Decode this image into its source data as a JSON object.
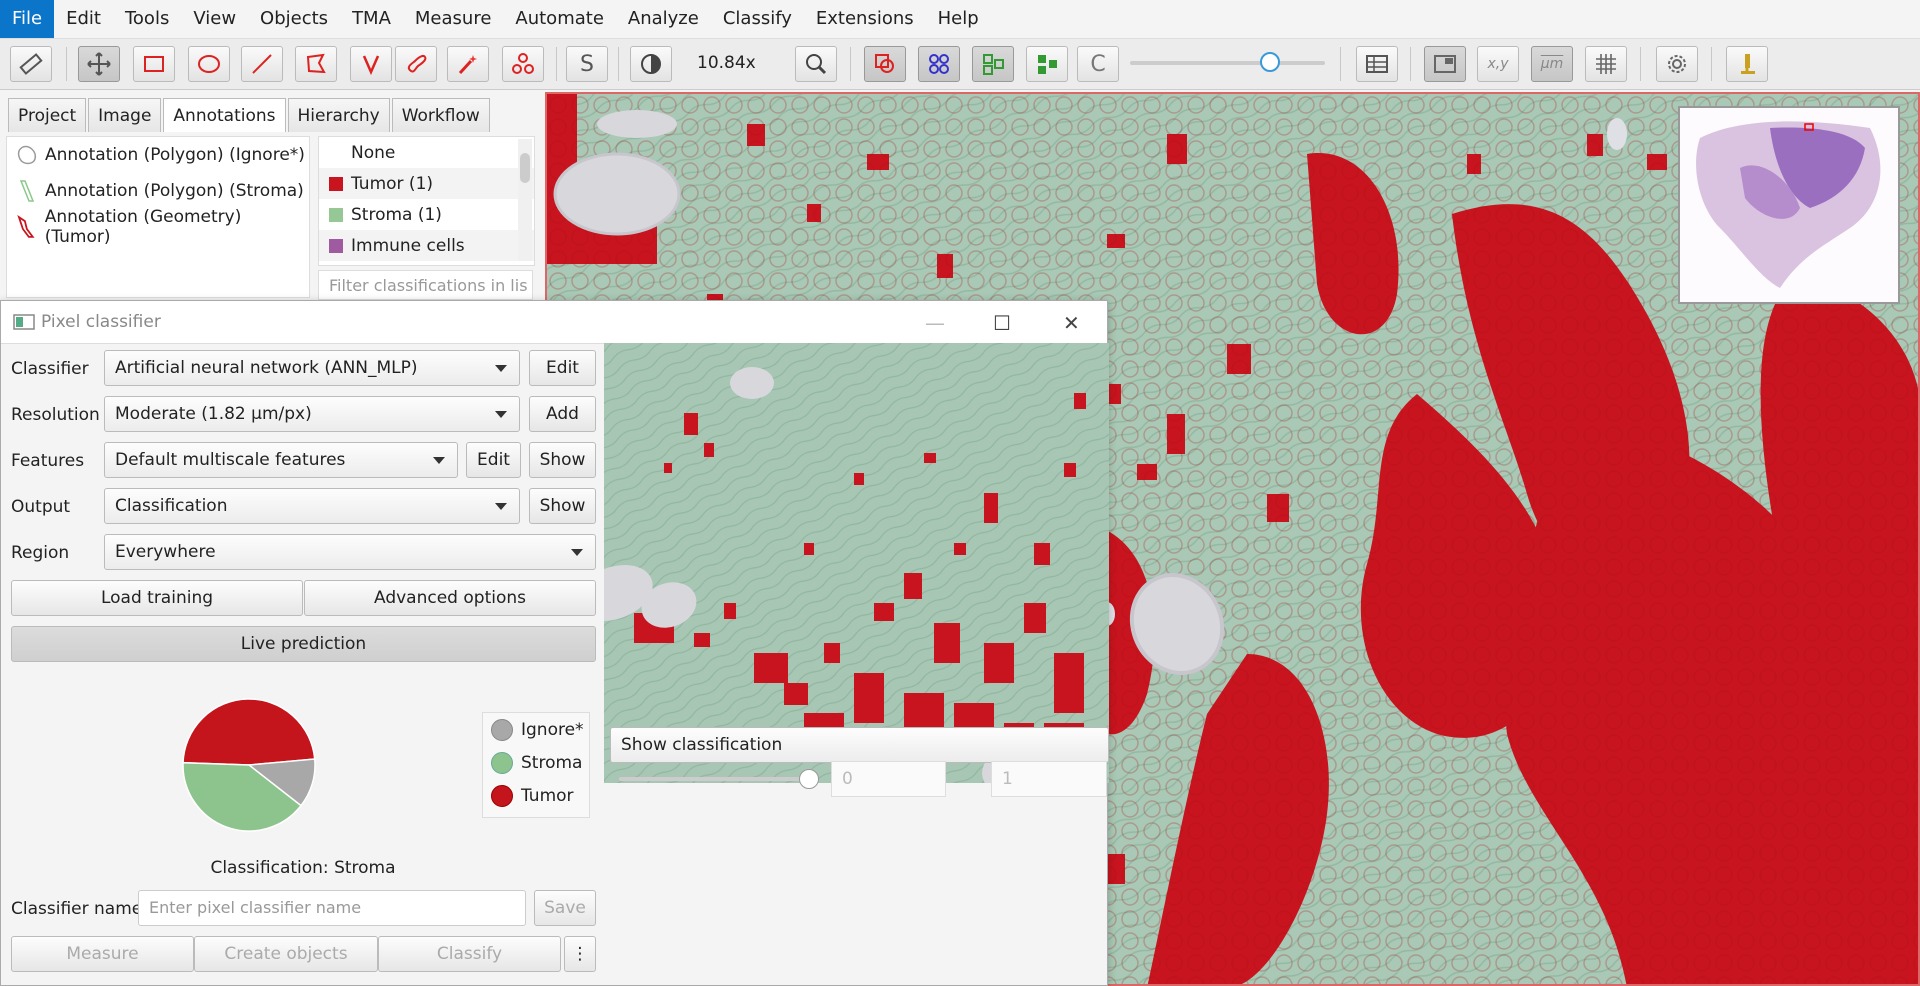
{
  "menu": [
    "File",
    "Edit",
    "Tools",
    "View",
    "Objects",
    "TMA",
    "Measure",
    "Automate",
    "Analyze",
    "Classify",
    "Extensions",
    "Help"
  ],
  "toolbar": {
    "zoom": "10.84x",
    "slider_level": 0.73
  },
  "tabs": [
    "Project",
    "Image",
    "Annotations",
    "Hierarchy",
    "Workflow"
  ],
  "annotations": [
    {
      "label": "Annotation (Polygon) (Ignore*)",
      "color": "#9a9a9a"
    },
    {
      "label": "Annotation (Polygon) (Stroma)",
      "color": "#8cc88c"
    },
    {
      "label": "Annotation (Geometry) (Tumor)",
      "color": "#c8141e"
    }
  ],
  "classes": [
    {
      "label": "None",
      "color": ""
    },
    {
      "label": "Tumor (1)",
      "color": "#c8141e"
    },
    {
      "label": "Stroma (1)",
      "color": "#96c896"
    },
    {
      "label": "Immune cells",
      "color": "#a05aa0"
    }
  ],
  "class_filter_placeholder": "Filter classifications in lis",
  "dialog": {
    "title": "Pixel classifier",
    "classifier_label": "Classifier",
    "classifier_value": "Artificial neural network (ANN_MLP)",
    "classifier_btn": "Edit",
    "resolution_label": "Resolution",
    "resolution_value": "Moderate (1.82 µm/px)",
    "resolution_btn": "Add",
    "features_label": "Features",
    "features_value": "Default multiscale features",
    "features_edit": "Edit",
    "features_show": "Show",
    "output_label": "Output",
    "output_value": "Classification",
    "output_show": "Show",
    "region_label": "Region",
    "region_value": "Everywhere",
    "load_training": "Load training",
    "advanced_options": "Advanced options",
    "live_prediction": "Live prediction",
    "pie": [
      {
        "name": "Ignore*",
        "fraction": 0.12,
        "color": "#a8a8a8"
      },
      {
        "name": "Stroma",
        "fraction": 0.4,
        "color": "#8dc48d"
      },
      {
        "name": "Tumor",
        "fraction": 0.48,
        "color": "#c4141c"
      }
    ],
    "pie_caption": "Classification: Stroma",
    "classifier_name_label": "Classifier name",
    "classifier_name_placeholder": "Enter pixel classifier name",
    "save": "Save",
    "measure": "Measure",
    "create_objects": "Create objects",
    "classify": "Classify",
    "more": "⋮",
    "show_classification": "Show classification",
    "spin1": "0",
    "spin2": "1"
  },
  "colors": {
    "accent": "#0a75c9",
    "tumor": "#c8141e",
    "stroma": "#a7c7b4"
  }
}
